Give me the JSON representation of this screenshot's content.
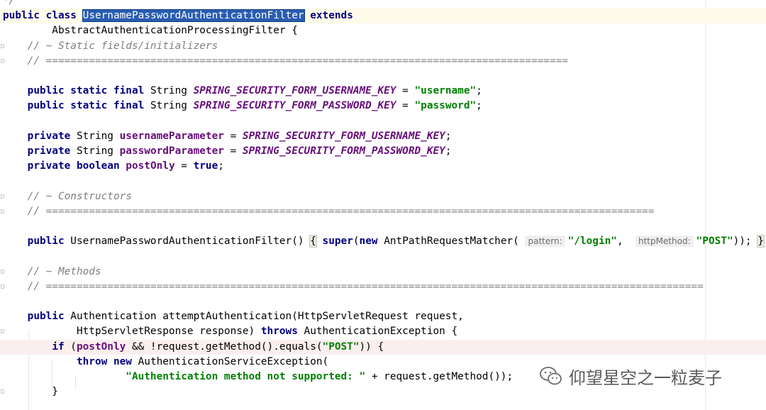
{
  "editor": {
    "lines": [
      {
        "id": "l0",
        "tokens": [
          [
            "cm",
            "*/"
          ]
        ]
      },
      {
        "id": "l1",
        "tokens": [
          [
            "kw",
            "public"
          ],
          [
            "p",
            " "
          ],
          [
            "kw",
            "class"
          ],
          [
            "p",
            " "
          ],
          [
            "sel",
            "UsernamePasswordAuthenticationFilter"
          ],
          [
            "p",
            " "
          ],
          [
            "kw",
            "extends"
          ]
        ]
      },
      {
        "id": "l2",
        "tokens": [
          [
            "p",
            "        AbstractAuthenticationProcessingFilter {"
          ]
        ]
      },
      {
        "id": "l3",
        "tokens": [
          [
            "cm",
            "    // ~ Static fields/initializers"
          ]
        ]
      },
      {
        "id": "l4",
        "tokens": [
          [
            "cm",
            "    // ====================================================================================="
          ]
        ]
      },
      {
        "id": "l5",
        "tokens": []
      },
      {
        "id": "l6",
        "tokens": [
          [
            "p",
            "    "
          ],
          [
            "kw",
            "public static final"
          ],
          [
            "p",
            " String "
          ],
          [
            "sf",
            "SPRING_SECURITY_FORM_USERNAME_KEY"
          ],
          [
            "p",
            " = "
          ],
          [
            "st",
            "\"username\""
          ],
          [
            "p",
            ";"
          ]
        ]
      },
      {
        "id": "l7",
        "tokens": [
          [
            "p",
            "    "
          ],
          [
            "kw",
            "public static final"
          ],
          [
            "p",
            " String "
          ],
          [
            "sf",
            "SPRING_SECURITY_FORM_PASSWORD_KEY"
          ],
          [
            "p",
            " = "
          ],
          [
            "st",
            "\"password\""
          ],
          [
            "p",
            ";"
          ]
        ]
      },
      {
        "id": "l8",
        "tokens": []
      },
      {
        "id": "l9",
        "tokens": [
          [
            "p",
            "    "
          ],
          [
            "kw",
            "private"
          ],
          [
            "p",
            " String "
          ],
          [
            "fd",
            "usernameParameter"
          ],
          [
            "p",
            " = "
          ],
          [
            "sf",
            "SPRING_SECURITY_FORM_USERNAME_KEY"
          ],
          [
            "p",
            ";"
          ]
        ]
      },
      {
        "id": "l10",
        "tokens": [
          [
            "p",
            "    "
          ],
          [
            "kw",
            "private"
          ],
          [
            "p",
            " String "
          ],
          [
            "fd",
            "passwordParameter"
          ],
          [
            "p",
            " = "
          ],
          [
            "sf",
            "SPRING_SECURITY_FORM_PASSWORD_KEY"
          ],
          [
            "p",
            ";"
          ]
        ]
      },
      {
        "id": "l11",
        "tokens": [
          [
            "p",
            "    "
          ],
          [
            "kw",
            "private boolean"
          ],
          [
            "p",
            " "
          ],
          [
            "fd",
            "postOnly"
          ],
          [
            "p",
            " = "
          ],
          [
            "kw",
            "true"
          ],
          [
            "p",
            ";"
          ]
        ]
      },
      {
        "id": "l12",
        "tokens": []
      },
      {
        "id": "l13",
        "tokens": [
          [
            "cm",
            "    // ~ Constructors"
          ]
        ]
      },
      {
        "id": "l14",
        "tokens": [
          [
            "cm",
            "    // ==================================================================================================="
          ]
        ]
      },
      {
        "id": "l15",
        "tokens": []
      },
      {
        "id": "l16",
        "tokens": [
          [
            "p",
            "    "
          ],
          [
            "kw",
            "public"
          ],
          [
            "p",
            " UsernamePasswordAuthenticationFilter() "
          ],
          [
            "bh",
            "{"
          ],
          [
            "p",
            " "
          ],
          [
            "kw",
            "super"
          ],
          [
            "p",
            "("
          ],
          [
            "kw",
            "new"
          ],
          [
            "p",
            " AntPathRequestMatcher( "
          ],
          [
            "hint",
            "pattern:"
          ],
          [
            "st",
            "\"/login\""
          ],
          [
            "p",
            ",  "
          ],
          [
            "hint",
            "httpMethod:"
          ],
          [
            "st",
            "\"POST\""
          ],
          [
            "p",
            ")); "
          ],
          [
            "bh",
            "}"
          ]
        ]
      },
      {
        "id": "l17",
        "tokens": []
      },
      {
        "id": "l18",
        "tokens": [
          [
            "cm",
            "    // ~ Methods"
          ]
        ]
      },
      {
        "id": "l19",
        "tokens": [
          [
            "cm",
            "    // ==========================================================================================================="
          ]
        ]
      },
      {
        "id": "l20",
        "tokens": []
      },
      {
        "id": "l21",
        "tokens": [
          [
            "p",
            "    "
          ],
          [
            "kw",
            "public"
          ],
          [
            "p",
            " Authentication attemptAuthentication(HttpServletRequest request,"
          ]
        ]
      },
      {
        "id": "l22",
        "tokens": [
          [
            "p",
            "            HttpServletResponse response) "
          ],
          [
            "kw",
            "throws"
          ],
          [
            "p",
            " AuthenticationException {"
          ]
        ]
      },
      {
        "id": "l23",
        "tokens": [
          [
            "p",
            "        "
          ],
          [
            "kw",
            "if"
          ],
          [
            "p",
            " ("
          ],
          [
            "fd",
            "postOnly"
          ],
          [
            "p",
            " && !request.getMethod().equals("
          ],
          [
            "st",
            "\"POST\""
          ],
          [
            "p",
            ")) {"
          ]
        ]
      },
      {
        "id": "l24",
        "tokens": [
          [
            "p",
            "            "
          ],
          [
            "kw",
            "throw new"
          ],
          [
            "p",
            " AuthenticationServiceException("
          ]
        ]
      },
      {
        "id": "l25",
        "tokens": [
          [
            "p",
            "                    "
          ],
          [
            "st",
            "\"Authentication method not supported: \""
          ],
          [
            "p",
            " + request.getMethod());"
          ]
        ]
      },
      {
        "id": "l26",
        "tokens": [
          [
            "p",
            "        }"
          ]
        ]
      }
    ],
    "highlighted_lines": {
      "l1": "yellow",
      "l23": "red"
    },
    "fold_markers": [
      "l3",
      "l4",
      "l13",
      "l14",
      "l18",
      "l19",
      "l22",
      "l26"
    ]
  },
  "watermark": {
    "text": "仰望星空之一粒麦子",
    "icon": "wechat-icon"
  },
  "colors": {
    "keyword": "#000080",
    "comment": "#808080",
    "string": "#008000",
    "static_field": "#660e7a",
    "selection": "#2a5db0"
  }
}
